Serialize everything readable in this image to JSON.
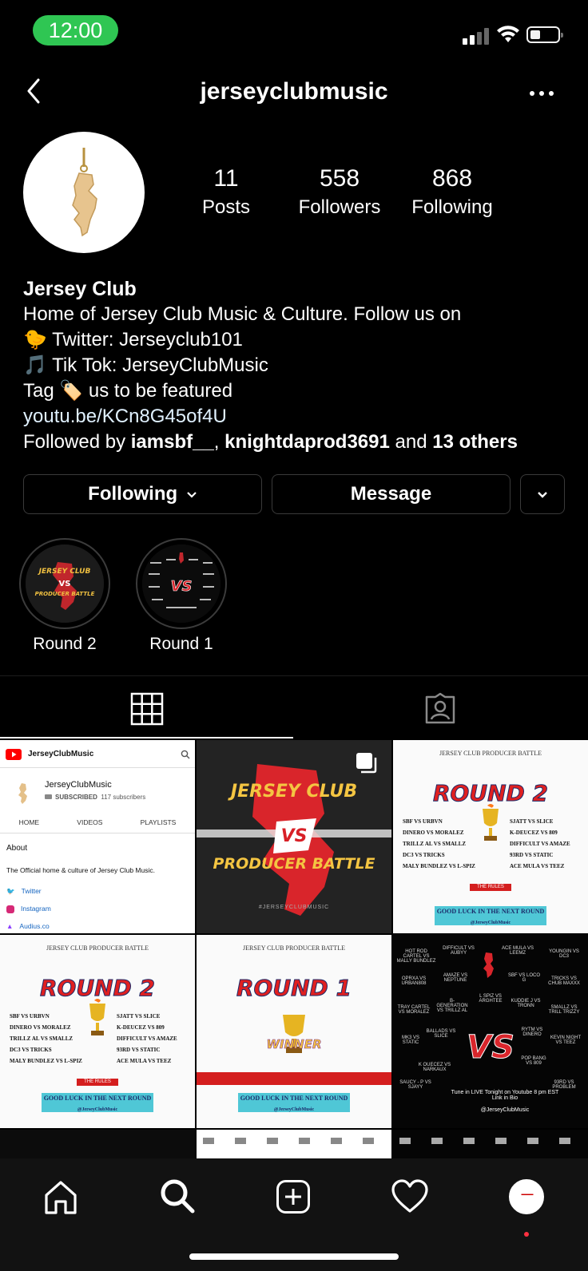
{
  "status_bar": {
    "time": "12:00"
  },
  "header": {
    "username": "jerseyclubmusic"
  },
  "profile": {
    "stats": [
      {
        "count": "11",
        "label": "Posts"
      },
      {
        "count": "558",
        "label": "Followers"
      },
      {
        "count": "868",
        "label": "Following"
      }
    ],
    "name": "Jersey Club",
    "bio_lines": [
      "Home of Jersey Club Music & Culture. Follow us on",
      "🐤 Twitter: Jerseyclub101",
      "🎵 Tik Tok: JerseyClubMusic",
      "Tag 🏷️ us to be featured"
    ],
    "link": "youtu.be/KCn8G45of4U",
    "followed_by": {
      "prefix": "Followed by ",
      "user1": "iamsbf__",
      "sep": ", ",
      "user2": "knightdaprod3691",
      "mid": " and ",
      "others": "13 others"
    }
  },
  "actions": {
    "following": "Following",
    "message": "Message"
  },
  "highlights": [
    {
      "label": "Round 2"
    },
    {
      "label": "Round 1"
    }
  ],
  "posts": {
    "youtube": {
      "app": "JerseyClubMusic",
      "channel": "JerseyClubMusic",
      "subscribed": "SUBSCRIBED",
      "subscribers": "117 subscribers",
      "tabs": [
        "HOME",
        "VIDEOS",
        "PLAYLISTS"
      ],
      "about_title": "About",
      "about_text": "The Official home & culture of Jersey Club Music.",
      "links": [
        "Twitter",
        "Instagram",
        "Audius.co"
      ]
    },
    "battle": {
      "line1": "JERSEY CLUB",
      "vs": "VS",
      "line2": "PRODUCER BATTLE",
      "tag": "#JERSEYCLUBMUSIC"
    },
    "round2": {
      "header": "JERSEY CLUB PRODUCER BATTLE",
      "title": "ROUND 2",
      "matches_left": [
        "SBF VS URBVN",
        "DINERO VS MORALEZ",
        "TRILLZ AL VS SMALLZ",
        "DC3 VS TRICKS",
        "MALY BUNDLEZ VS L-SPIZ"
      ],
      "matches_right": [
        "SJATT VS SLICE",
        "K-DEUCEZ VS 809",
        "DIFFICULT VS AMAZE",
        "93RD VS STATIC",
        "ACE MULA VS TEEZ"
      ],
      "rules": "THE RULES",
      "luck": "GOOD LUCK IN THE NEXT ROUND",
      "follow": "@JerseyClubMusic"
    },
    "round1": {
      "header": "JERSEY CLUB PRODUCER BATTLE",
      "title": "ROUND 1",
      "winner": "WINNER",
      "luck": "GOOD LUCK IN THE NEXT ROUND",
      "follow": "@JerseyClubMusic"
    },
    "bracket": {
      "names": [
        "HOT ROD CARTEL VS MALLY BUNDLEZ",
        "DIFFICULT VS AUBYY",
        "ACE MULA VS LEEMZ",
        "YOUNGIN VS DC3",
        "OPRXA VS URBAN808",
        "AMAZE VS NEPTUNE",
        "SBF VS LOCO G",
        "TRICKS VS CHUB MAXXX",
        "TRAY CARTEL VS MORALEZ",
        "B-GENERATION VS TRILLZ AL",
        "L SPIZ VS ARGHTEE",
        "KUDDIE J VS TRONN",
        "SMALLZ VS TRILL TRIZZY",
        "MK3 VS STATIC",
        "BALLADS VS SLICE",
        "RYTM VS DINERO",
        "KEVIN NIGHT VS TEEZ",
        "K OUECEZ VS NARKAUX",
        "POP BANG VS 809",
        "SAUCY - P VS SJAYY",
        "93RD VS PROBLEM"
      ],
      "footer": "Tune in LIVE Tonight on Youtube 8 pm EST",
      "footer2": "Link in Bio",
      "follow": "@JerseyClubMusic"
    }
  }
}
